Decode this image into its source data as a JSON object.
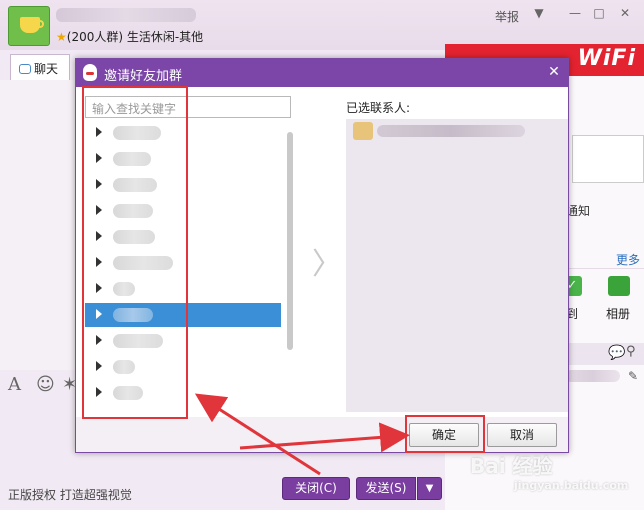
{
  "chat_window": {
    "group_subtitle": "(200人群) 生活休闲-其他",
    "star": "★",
    "report": "举报",
    "win_menu": "▼",
    "win_min": "—",
    "win_max": "□",
    "win_close": "✕",
    "tab_chat": "聊天",
    "footer_left": "正版授权  打造超强视觉",
    "close_button": "关闭(C)",
    "send_button": "发送(S)",
    "send_arrow": "▼"
  },
  "right_panel": {
    "ad_text": "WiFi",
    "notice_fragment": "通知",
    "more": "更多",
    "sign_in_fragment": "到",
    "album": "相册"
  },
  "invite_dialog": {
    "title": "邀请好友加群",
    "search_placeholder": "输入查找关键字",
    "selected_contacts_label": "已选联系人:",
    "ok_button": "确定",
    "cancel_button": "取消",
    "selected_row_index": 7
  },
  "watermark": {
    "main": "Bai 经验",
    "sub": "jingyan.baidu.com"
  },
  "colors": {
    "title_bar": "#7b46a8",
    "selection": "#3a8fd6",
    "annotation_red": "#e0353b",
    "button_purple": "#7a3da0"
  }
}
